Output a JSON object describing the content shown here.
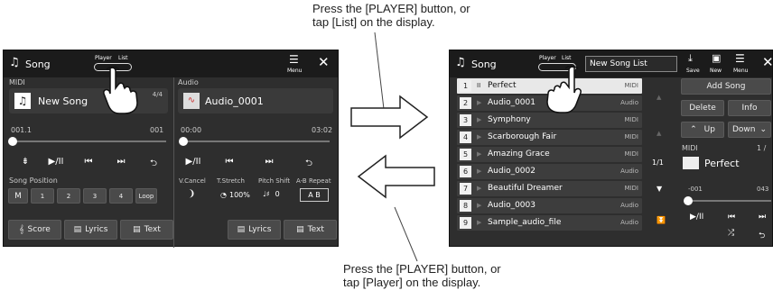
{
  "captions": {
    "top_line1": "Press the [PLAYER] button, or",
    "top_line2": "tap [List] on the display.",
    "bottom_line1": "Press the [PLAYER] button, or",
    "bottom_line2": "tap [Player] on the display."
  },
  "player_screen": {
    "title": "Song",
    "tab_player": "Player",
    "tab_list": "List",
    "menu_label": "Menu",
    "midi": {
      "section_label": "MIDI",
      "song_name": "New Song",
      "bar_count": "4/4",
      "position": "001.1",
      "end": "001",
      "progress": 0
    },
    "audio": {
      "section_label": "Audio",
      "song_name": "Audio_0001",
      "time_start": "00:00",
      "time_end": "03:02",
      "progress": 0
    },
    "song_position": {
      "label": "Song Position",
      "buttons": [
        "M",
        "1",
        "2",
        "3",
        "4"
      ],
      "loop": "Loop"
    },
    "audio_controls": {
      "vcancel_label": "V.Cancel",
      "tstretch_label": "T.Stretch",
      "tstretch_value": "100%",
      "pitch_label": "Pitch Shift",
      "pitch_value": "0",
      "ab_label": "A-B Repeat",
      "ab_value": "A B"
    },
    "footer_left": {
      "score": "Score",
      "lyrics": "Lyrics",
      "text": "Text"
    },
    "footer_right": {
      "lyrics": "Lyrics",
      "text": "Text"
    }
  },
  "list_screen": {
    "title": "Song",
    "tab_player": "Player",
    "tab_list": "List",
    "list_name": "New Song List",
    "toolbar": {
      "save": "Save",
      "new": "New",
      "menu": "Menu"
    },
    "rows": [
      {
        "num": "1",
        "name": "Perfect",
        "type": "MIDI",
        "selected": true
      },
      {
        "num": "2",
        "name": "Audio_0001",
        "type": "Audio",
        "selected": false
      },
      {
        "num": "3",
        "name": "Symphony",
        "type": "MIDI",
        "selected": false
      },
      {
        "num": "4",
        "name": "Scarborough Fair",
        "type": "MIDI",
        "selected": false
      },
      {
        "num": "5",
        "name": "Amazing Grace",
        "type": "MIDI",
        "selected": false
      },
      {
        "num": "6",
        "name": "Audio_0002",
        "type": "Audio",
        "selected": false
      },
      {
        "num": "7",
        "name": "Beautiful Dreamer",
        "type": "MIDI",
        "selected": false
      },
      {
        "num": "8",
        "name": "Audio_0003",
        "type": "Audio",
        "selected": false
      },
      {
        "num": "9",
        "name": "Sample_audio_file",
        "type": "Audio",
        "selected": false
      }
    ],
    "page_indicator": "1/1",
    "actions": {
      "add_song": "Add Song",
      "delete": "Delete",
      "info": "Info",
      "up": "Up",
      "down": "Down"
    },
    "midi_panel": {
      "label": "MIDI",
      "count": "1 /",
      "song": "Perfect",
      "pos": "-001",
      "end": "043"
    }
  }
}
